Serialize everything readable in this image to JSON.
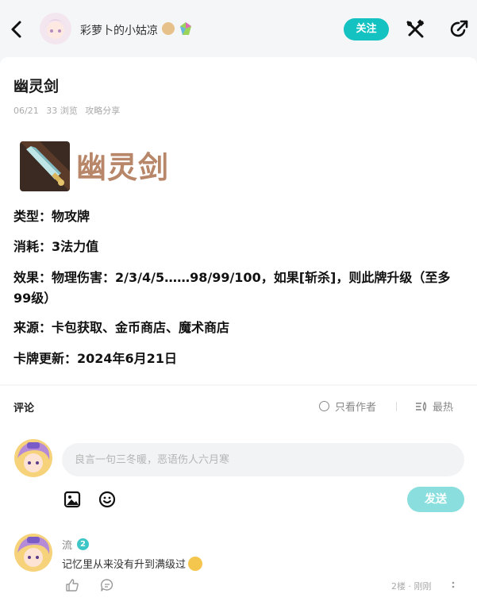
{
  "header": {
    "author_name": "彩萝卜的小姑凉",
    "follow_label": "关注",
    "icons": {
      "back": "chevron-left-icon",
      "tools": "tools-icon",
      "share": "share-icon"
    }
  },
  "post": {
    "title": "幽灵剑",
    "meta": {
      "date": "06/21",
      "views": "33 浏览",
      "category": "攻略分享"
    },
    "card_name": "幽灵剑",
    "attributes": [
      {
        "label": "类型：",
        "value": "物攻牌"
      },
      {
        "label": "消耗：",
        "value": "3法力值"
      },
      {
        "label": "效果：",
        "value": "物理伤害：2/3/4/5……98/99/100，如果[斩杀]，则此牌升级（至多99级）"
      },
      {
        "label": "来源：",
        "value": "卡包获取、金币商店、魔术商店"
      },
      {
        "label": "卡牌更新：",
        "value": "2024年6月21日"
      }
    ]
  },
  "comments": {
    "title": "评论",
    "only_author_label": "只看作者",
    "sort_label": "最热",
    "input_placeholder": "良言一句三冬暖，恶语伤人六月寒",
    "send_label": "发送",
    "items": [
      {
        "user": "流",
        "level": "2",
        "text": "记忆里从来没有升到满级过",
        "floor": "2楼 · 刚刚"
      }
    ]
  },
  "colors": {
    "accent": "#14c2c2",
    "send_disabled": "#8adfde",
    "card_title": "#b8876a"
  }
}
